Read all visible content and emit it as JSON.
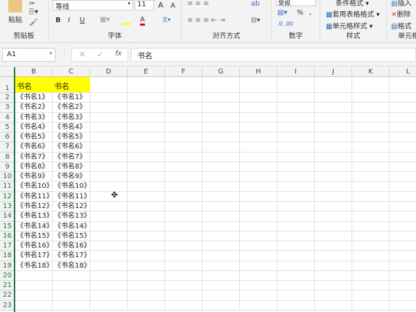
{
  "ribbon": {
    "clipboard": {
      "paste": "粘贴",
      "label": "剪贴板"
    },
    "font": {
      "name": "等线",
      "size": "11",
      "bold": "B",
      "italic": "I",
      "underline": "U",
      "label": "字体",
      "grow": "A",
      "shrink": "A",
      "color_a": "A"
    },
    "alignment": {
      "label": "对齐方式"
    },
    "number": {
      "format": "常规",
      "percent": "%",
      "comma": ",",
      "label": "数字"
    },
    "styles": {
      "cond": "条件格式",
      "table": "套用表格格式",
      "cell": "单元格样式",
      "label": "样式"
    },
    "cells": {
      "insert": "插入",
      "delete": "删除",
      "format": "格式",
      "label": "单元格"
    },
    "colors": {
      "fill": "#ffff00",
      "font": "#ff0000"
    }
  },
  "formula_bar": {
    "name_box": "A1",
    "fx": "fx",
    "cancel": "✕",
    "enter": "✓",
    "value": "书名"
  },
  "columns": [
    "B",
    "C",
    "D",
    "E",
    "F",
    "G",
    "H",
    "I",
    "J",
    "K",
    "L"
  ],
  "rows": [
    "1",
    "2",
    "3",
    "4",
    "5",
    "6",
    "7",
    "8",
    "9",
    "10",
    "11",
    "12",
    "13",
    "14",
    "15",
    "16",
    "17",
    "18",
    "19",
    "20",
    "21",
    "22",
    "23"
  ],
  "header": {
    "B": "书名",
    "C": "书名"
  },
  "colB": [
    "《书名1》",
    "《书名2》",
    "《书名3》",
    "《书名4》",
    "《书名5》",
    "《书名6》",
    "《书名7》",
    "《书名8》",
    "《书名9》",
    "《书名10》",
    "《书名11》",
    "《书名12》",
    "《书名13》",
    "《书名14》",
    "《书名15》",
    "《书名16》",
    "《书名17》",
    "《书名18》"
  ],
  "colC": [
    "《书名1》",
    "《书名2》",
    "《书名3》",
    "《书名4》",
    "《书名5》",
    "《书名6》",
    "《书名7》",
    "《书名8》",
    "《书名9》",
    "《书名10》",
    "《书名11》",
    "《书名12》",
    "《书名13》",
    "《书名14》",
    "《书名15》",
    "《书名16》",
    "《书名17》",
    "《书名18》"
  ]
}
